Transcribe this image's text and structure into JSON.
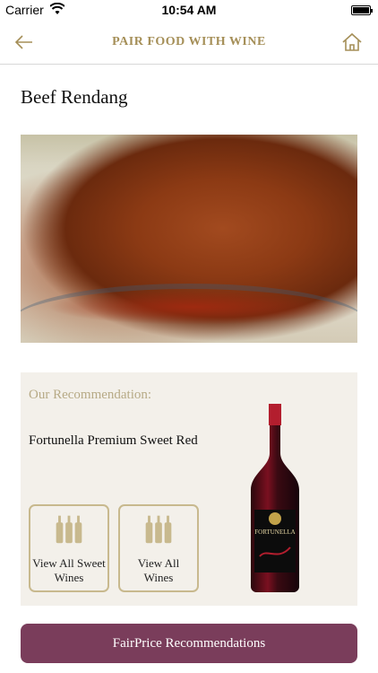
{
  "status_bar": {
    "carrier": "Carrier",
    "time": "10:54 AM"
  },
  "nav": {
    "title": "PAIR FOOD WITH WINE",
    "back_icon": "arrow-left-icon",
    "home_icon": "home-icon"
  },
  "dish": {
    "title": "Beef Rendang"
  },
  "recommendation": {
    "label": "Our Recommendation:",
    "wine_name": "Fortunella Premium Sweet Red",
    "buttons": [
      {
        "label": "View All Sweet Wines",
        "icon": "wine-bottles-icon"
      },
      {
        "label": "View All Wines",
        "icon": "wine-bottles-icon"
      }
    ],
    "bottle_label": "FORTUNELLA"
  },
  "footer": {
    "button_label": "FairPrice Recommendations"
  },
  "colors": {
    "gold": "#a58f58",
    "card_bg": "#f3f0ea",
    "accent": "#7a3d5b"
  }
}
